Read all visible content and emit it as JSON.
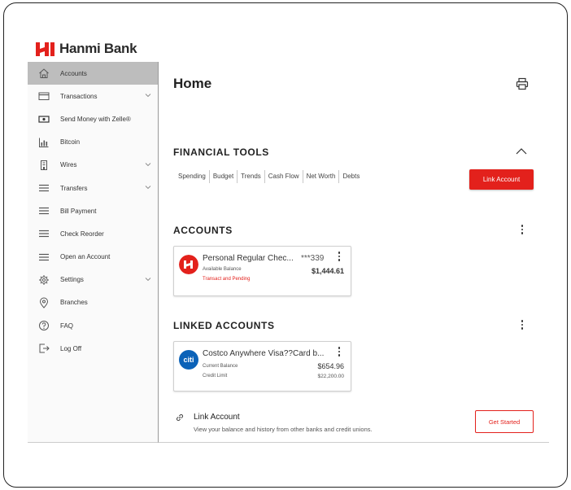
{
  "brand": {
    "name": "Hanmi Bank",
    "accent": "#e3211c"
  },
  "sidebar": {
    "items": [
      {
        "label": "Accounts",
        "icon": "home-icon",
        "active": true,
        "expandable": false
      },
      {
        "label": "Transactions",
        "icon": "card-icon",
        "active": false,
        "expandable": true
      },
      {
        "label": "Send Money with Zelle®",
        "icon": "money-icon",
        "active": false,
        "expandable": false
      },
      {
        "label": "Bitcoin",
        "icon": "chart-icon",
        "active": false,
        "expandable": false
      },
      {
        "label": "Wires",
        "icon": "building-icon",
        "active": false,
        "expandable": true
      },
      {
        "label": "Transfers",
        "icon": "menu-icon",
        "active": false,
        "expandable": true
      },
      {
        "label": "Bill Payment",
        "icon": "menu-icon",
        "active": false,
        "expandable": false
      },
      {
        "label": "Check Reorder",
        "icon": "menu-icon",
        "active": false,
        "expandable": false
      },
      {
        "label": "Open an Account",
        "icon": "menu-icon",
        "active": false,
        "expandable": false
      },
      {
        "label": "Settings",
        "icon": "gear-icon",
        "active": false,
        "expandable": true
      },
      {
        "label": "Branches",
        "icon": "location-pin-icon",
        "active": false,
        "expandable": false
      },
      {
        "label": "FAQ",
        "icon": "question-icon",
        "active": false,
        "expandable": false
      },
      {
        "label": "Log Off",
        "icon": "logout-icon",
        "active": false,
        "expandable": false
      }
    ]
  },
  "main": {
    "title": "Home",
    "financial_tools": {
      "title": "FINANCIAL TOOLS",
      "tools": [
        "Spending",
        "Budget",
        "Trends",
        "Cash Flow",
        "Net Worth",
        "Debts"
      ],
      "link_account_button": "Link Account"
    },
    "accounts": {
      "title": "ACCOUNTS",
      "card": {
        "name": "Personal Regular Chec...",
        "number": "***339",
        "balance_label": "Available Balance",
        "balance": "$1,444.61",
        "status": "Transact and Pending"
      }
    },
    "linked_accounts": {
      "title": "LINKED ACCOUNTS",
      "card": {
        "logo_text": "citi",
        "name": "Costco Anywhere Visa??Card b...",
        "balance_label": "Current Balance",
        "balance": "$654.96",
        "limit_label": "Credit Limit",
        "limit": "$22,200.00"
      }
    },
    "link_account": {
      "title": "Link Account",
      "description": "View your balance and history from other banks and credit unions.",
      "button": "Get Started"
    }
  }
}
